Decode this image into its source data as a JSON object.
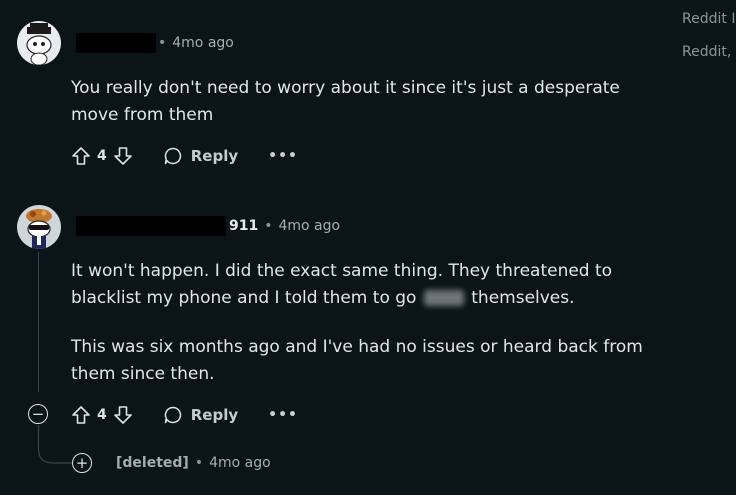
{
  "sidebar": {
    "line1": "Reddit I",
    "line2": "Reddit,"
  },
  "comments": [
    {
      "username_suffix": "",
      "separator": "•",
      "time": "4mo ago",
      "body": [
        "You really don't need to worry about it since it's just a desperate",
        "move from them"
      ],
      "votes": "4",
      "reply_label": "Reply",
      "more_label": "•••"
    },
    {
      "username_suffix": "911",
      "separator": "•",
      "time": "4mo ago",
      "paragraph1_line1": "It won't happen. I did the exact same thing. They threatened to",
      "paragraph1_line2_a": "blacklist my phone and I told them to go",
      "paragraph1_line2_b": "themselves.",
      "paragraph2": [
        "This was six months ago and I've had no issues or heard back from",
        "them since then."
      ],
      "votes": "4",
      "reply_label": "Reply",
      "more_label": "•••",
      "collapse_symbol": "−"
    }
  ],
  "deleted_reply": {
    "expand_symbol": "+",
    "author": "[deleted]",
    "separator": "•",
    "time": "4mo ago"
  }
}
